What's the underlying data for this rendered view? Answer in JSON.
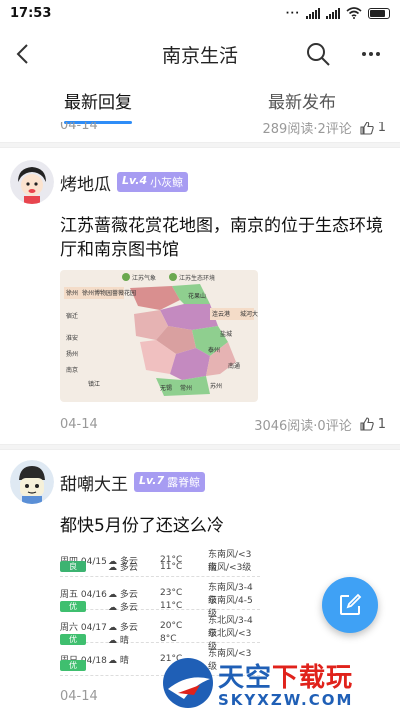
{
  "status_bar": {
    "time": "17:53"
  },
  "nav": {
    "title": "南京生活"
  },
  "tabs": [
    {
      "label": "最新回复",
      "active": true
    },
    {
      "label": "最新发布",
      "active": false
    }
  ],
  "prev_post": {
    "date": "04-14",
    "stats": "289阅读·2评论",
    "likes": "1"
  },
  "posts": [
    {
      "user": "烤地瓜",
      "level": "Lv.4",
      "rank": "小灰鲸",
      "title": "江苏蔷薇花赏花地图，南京的位于生态环境厅和南京图书馆",
      "date": "04-14",
      "stats": "3046阅读·0评论",
      "likes": "1",
      "map_labels": [
        "江苏气象",
        "江苏生态环境",
        "徐州",
        "徐州博物园蔷薇花园",
        "连云港",
        "城河大道路",
        "花果山",
        "宿迁",
        "盐城",
        "淮安",
        "扬州",
        "泰州",
        "南通",
        "南京",
        "镇江",
        "常州",
        "无锡",
        "苏州"
      ]
    },
    {
      "user": "甜嘲大王",
      "level": "Lv.7",
      "rank": "露脊鲸",
      "title": "都快5月份了还这么冷",
      "date": "04-14",
      "weather": [
        {
          "day": "周四 04/15",
          "tag": "良",
          "tag_color": "#3cb371",
          "cond1": "多云",
          "t1": "21°C",
          "wind1": "东南风/<3级",
          "cond2": "多云",
          "t2": "11°C",
          "wind2": "南风/<3级"
        },
        {
          "day": "周五 04/16",
          "tag": "优",
          "tag_color": "#3fbf6f",
          "cond1": "多云",
          "t1": "23°C",
          "wind1": "东南风/3-4级",
          "cond2": "多云",
          "t2": "11°C",
          "wind2": "东南风/4-5级"
        },
        {
          "day": "周六 04/17",
          "tag": "优",
          "tag_color": "#3fbf6f",
          "cond1": "多云",
          "t1": "20°C",
          "wind1": "东北风/3-4级",
          "cond2": "晴",
          "t2": "8°C",
          "wind2": "东北风/<3级"
        },
        {
          "day": "周日 04/18",
          "tag": "优",
          "tag_color": "#3fbf6f",
          "cond1": "晴",
          "t1": "21°C",
          "wind1": "东南风/<3级",
          "cond2": "",
          "t2": "",
          "wind2": ""
        }
      ]
    }
  ],
  "watermark": {
    "brand": "天空",
    "brand_red": "下载玩",
    "url": "SKYXZW.COM"
  },
  "colors": {
    "accent": "#2f8df7",
    "badge": "#a79cf2",
    "fab": "#3fa1f5"
  },
  "icons": [
    "back-arrow-icon",
    "search-icon",
    "more-icon",
    "thumb-up-icon",
    "edit-icon"
  ]
}
